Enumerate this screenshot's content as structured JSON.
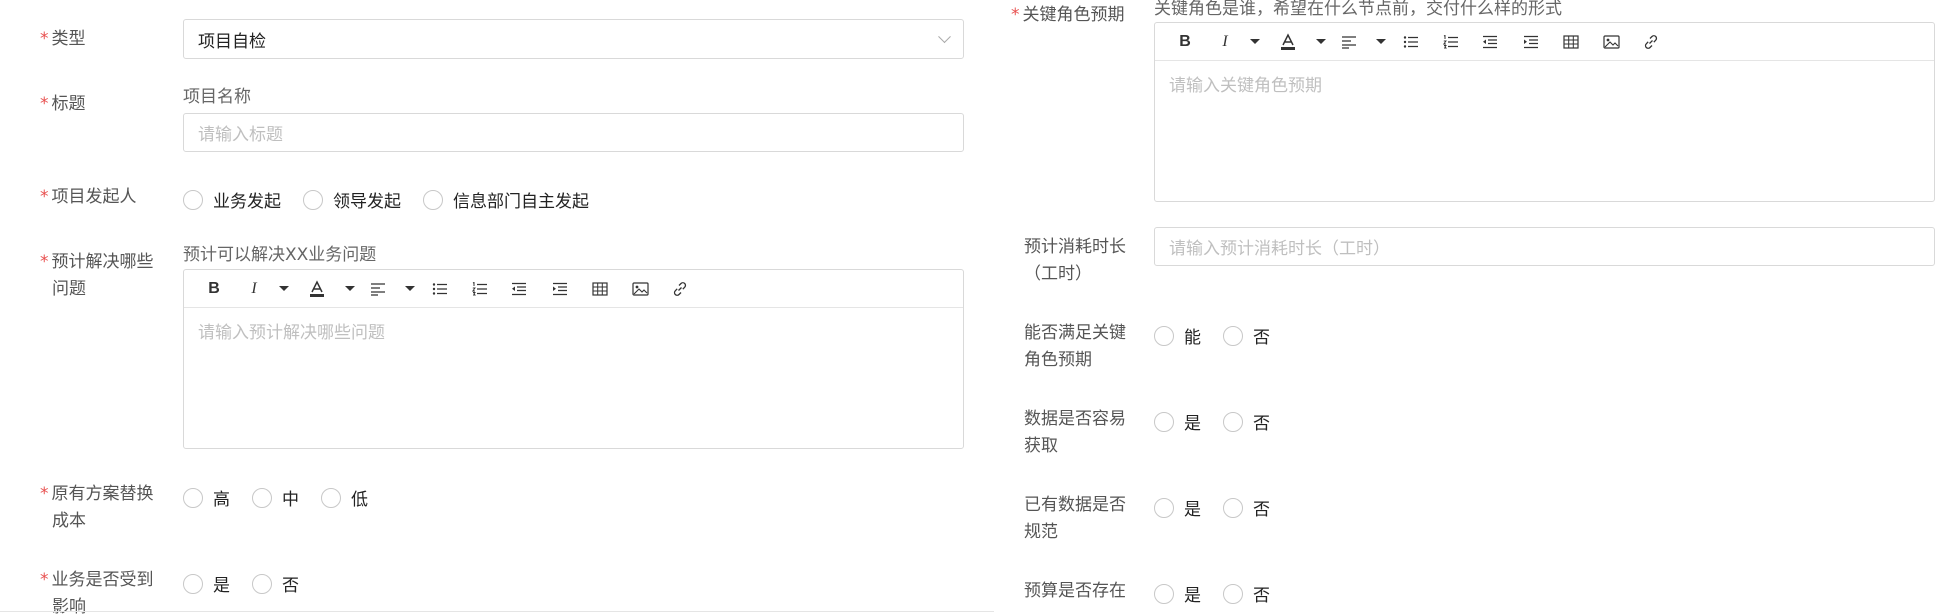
{
  "left": {
    "type": {
      "label": "类型",
      "value": "项目自检"
    },
    "title": {
      "label": "标题",
      "hint": "项目名称",
      "placeholder": "请输入标题"
    },
    "initiator": {
      "label": "项目发起人",
      "options": [
        "业务发起",
        "领导发起",
        "信息部门自主发起"
      ]
    },
    "problems": {
      "label_line1": "预计解决哪些",
      "label_line2": "问题",
      "hint": "预计可以解决XX业务问题",
      "placeholder": "请输入预计解决哪些问题"
    },
    "replace_cost": {
      "label_line1": "原有方案替换",
      "label_line2": "成本",
      "options": [
        "高",
        "中",
        "低"
      ]
    },
    "business_impact": {
      "label_line1": "业务是否受到",
      "label_line2": "影响",
      "options": [
        "是",
        "否"
      ]
    }
  },
  "right": {
    "key_role": {
      "label": "关键角色预期",
      "hint": "关键角色是谁，希望在什么节点前，交付什么样的形式",
      "placeholder": "请输入关键角色预期"
    },
    "duration": {
      "label_line1": "预计消耗时长",
      "label_line2": "（工时）",
      "placeholder": "请输入预计消耗时长（工时）"
    },
    "meet_expect": {
      "label_line1": "能否满足关键",
      "label_line2": "角色预期",
      "options": [
        "能",
        "否"
      ]
    },
    "data_easy": {
      "label_line1": "数据是否容易",
      "label_line2": "获取",
      "options": [
        "是",
        "否"
      ]
    },
    "data_standard": {
      "label_line1": "已有数据是否",
      "label_line2": "规范",
      "options": [
        "是",
        "否"
      ]
    },
    "budget": {
      "label": "预算是否存在",
      "options": [
        "是",
        "否"
      ]
    }
  },
  "toolbar": {
    "bold": "B",
    "italic": "I",
    "icons": [
      "bold-icon",
      "italic-icon",
      "dropdown-icon",
      "font-color-icon",
      "dropdown-icon",
      "align-icon",
      "dropdown-icon",
      "bullet-list-icon",
      "numbered-list-icon",
      "indent-decrease-icon",
      "indent-increase-icon",
      "table-icon",
      "image-icon",
      "link-icon"
    ]
  },
  "colors": {
    "required": "#e8504f",
    "border": "#d9d9d9",
    "placeholder": "#bfbfbf",
    "font_color_bar": "#333333"
  }
}
